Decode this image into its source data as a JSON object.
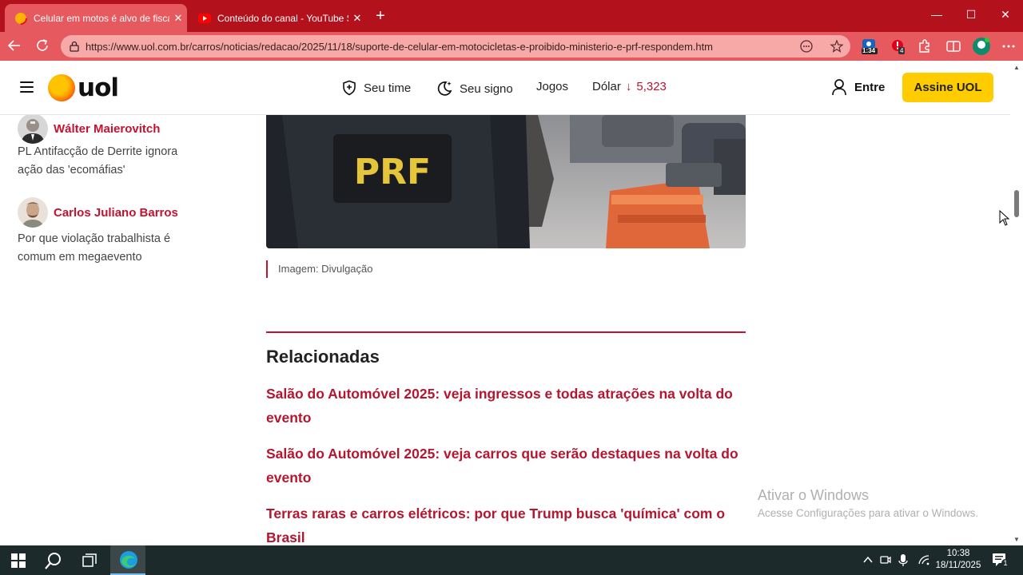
{
  "browser": {
    "tabs": [
      {
        "title": "Celular em motos é alvo de fiscali",
        "active": true
      },
      {
        "title": "Conteúdo do canal - YouTube Stu",
        "active": false
      }
    ],
    "close_glyph": "✕",
    "new_tab_glyph": "+",
    "window_controls": {
      "minimize": "—",
      "maximize": "☐",
      "close": "✕"
    },
    "url": "https://www.uol.com.br/carros/noticias/redacao/2025/11/18/suporte-de-celular-em-motocicletas-e-proibido-ministerio-e-prf-respondem.htm",
    "extensions": {
      "badge_time": "1:34",
      "badge_count": "4"
    },
    "colors": {
      "titlebar": "#b3121c",
      "toolbar": "#e65a5f",
      "address_bar": "#f7a9a8"
    }
  },
  "site": {
    "logo": "uol",
    "nav": {
      "seu_time": "Seu time",
      "seu_signo": "Seu signo",
      "jogos": "Jogos",
      "dolar_label": "Dólar",
      "dolar_value": "5,323",
      "dolar_arrow": "↓"
    },
    "entre": "Entre",
    "assine": "Assine UOL",
    "colors": {
      "accent": "#c4122f",
      "subscribe": "#ffcc00"
    }
  },
  "sidebar": {
    "columns": [
      {
        "author": "Wálter Maierovitch",
        "headline": "PL Antifacção de Derrite ignora ação das 'ecomáfias'"
      },
      {
        "author": "Carlos Juliano Barros",
        "headline": "Por que violação trabalhista é comum em megaevento"
      }
    ]
  },
  "article": {
    "image_text": "PRF",
    "caption": "Imagem: Divulgação",
    "related_title": "Relacionadas",
    "related": [
      "Salão do Automóvel 2025: veja ingressos e todas atrações na volta do evento",
      "Salão do Automóvel 2025: veja carros que serão destaques na volta do evento",
      "Terras raras e carros elétricos: por que Trump busca 'química' com o Brasil"
    ]
  },
  "watermark": {
    "line1": "Ativar o Windows",
    "line2": "Acesse Configurações para ativar o Windows."
  },
  "taskbar": {
    "time": "10:38",
    "date": "18/11/2025",
    "notification_count": "1"
  }
}
